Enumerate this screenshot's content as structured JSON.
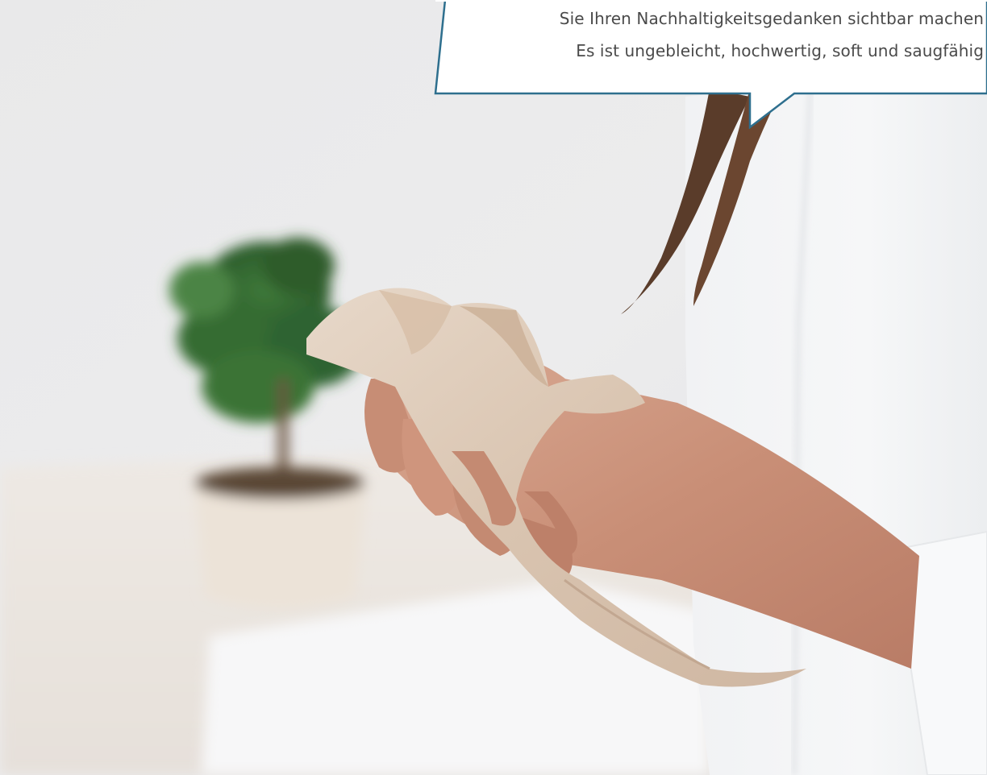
{
  "speech_bubble": {
    "lines": [
      "Sie Ihren Nachhaltigkeitsgedanken sichtbar machen",
      "Es ist ungebleicht, hochwertig, soft und saugfähig"
    ],
    "border_color": "#2e6f8e",
    "text_color": "#4a4a4a"
  },
  "photo": {
    "subject": "hand-towel-icon",
    "background_plant": "potted-plant-icon"
  }
}
